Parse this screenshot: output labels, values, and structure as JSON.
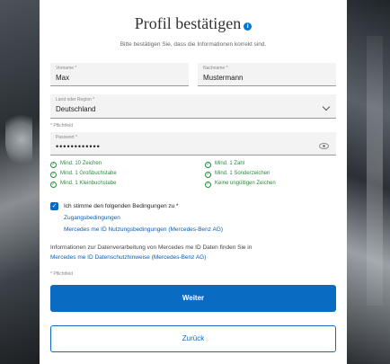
{
  "header": {
    "title": "Profil bestätigen",
    "subtitle": "Bitte bestätigen Sie, dass die Informationen korrekt sind."
  },
  "form": {
    "firstname": {
      "label": "Vorname *",
      "value": "Max"
    },
    "lastname": {
      "label": "Nachname *",
      "value": "Mustermann"
    },
    "country": {
      "label": "Land oder Region *",
      "value": "Deutschland"
    },
    "required_note_1": "* Pflichtfeld",
    "password": {
      "label": "Passwort *",
      "value": "••••••••••••"
    },
    "rules": [
      "Mind. 10 Zeichen",
      "Mind. 1 Zahl",
      "Mind. 1 Großbuchstabe",
      "Mind. 1 Sonderzeichen",
      "Mind. 1 Kleinbuchstabe",
      "Keine ungültigen Zeichen"
    ],
    "agree_text": "Ich stimme den folgenden Bedingungen zu *",
    "links": {
      "terms": "Zugangsbedingungen",
      "me_id_terms": "Mercedes me ID Nutzungsbedingungen (Mercedes-Benz AG)"
    },
    "info_text": "Informationen zur Datenverarbeitung von Mercedes me ID Daten finden Sie in",
    "privacy_link": "Mercedes me ID Datenschutzhinweise (Mercedes-Benz AG)",
    "required_note_2": "* Pflichtfeld"
  },
  "buttons": {
    "continue": "Weiter",
    "back": "Zurück"
  },
  "colors": {
    "primary": "#0a6bc2",
    "success": "#2b8a3e"
  }
}
